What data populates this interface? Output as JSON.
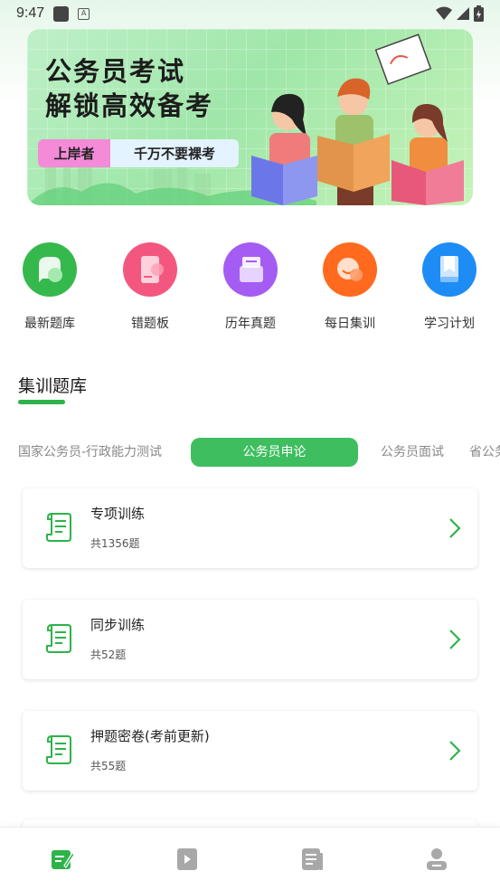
{
  "status_bar": {
    "time": "9:47",
    "icons": [
      "app-notification-icon",
      "a-badge-icon",
      "wifi-icon",
      "signal-icon",
      "battery-icon"
    ]
  },
  "banner": {
    "title_line1": "公务员考试",
    "title_line2": "解锁高效备考",
    "tag_left": "上岸者",
    "tag_right": "千万不要裸考"
  },
  "quick_links": [
    {
      "label": "最新题库",
      "icon": "chat-bubble-icon",
      "color": "#36b94c"
    },
    {
      "label": "错题板",
      "icon": "phone-card-icon",
      "color": "#f3577f"
    },
    {
      "label": "历年真题",
      "icon": "archive-box-icon",
      "color": "#a45cf2"
    },
    {
      "label": "每日集训",
      "icon": "clock-circle-icon",
      "color": "#ff6a1f"
    },
    {
      "label": "学习计划",
      "icon": "bookmark-icon",
      "color": "#1e8cf5"
    }
  ],
  "section": {
    "title": "集训题库"
  },
  "tabs": [
    {
      "label": "国家公务员-行政能力测试",
      "active": false
    },
    {
      "label": "公务员申论",
      "active": true
    },
    {
      "label": "公务员面试",
      "active": false
    },
    {
      "label": "省公务员",
      "active": false
    }
  ],
  "cards": [
    {
      "title": "专项训练",
      "count": "共1356题"
    },
    {
      "title": "同步训练",
      "count": "共52题"
    },
    {
      "title": "押题密卷(考前更新)",
      "count": "共55题"
    }
  ],
  "bottom_nav": [
    {
      "name": "nav-exercise",
      "icon": "edit-note-icon",
      "active": true
    },
    {
      "name": "nav-video",
      "icon": "video-play-icon",
      "active": false
    },
    {
      "name": "nav-articles",
      "icon": "document-list-icon",
      "active": false
    },
    {
      "name": "nav-profile",
      "icon": "user-icon",
      "active": false
    }
  ],
  "colors": {
    "accent": "#2db34a",
    "tab_active": "#3fbe5f",
    "nav_active": "#2db34a",
    "nav_inactive": "#a8a8a8"
  }
}
